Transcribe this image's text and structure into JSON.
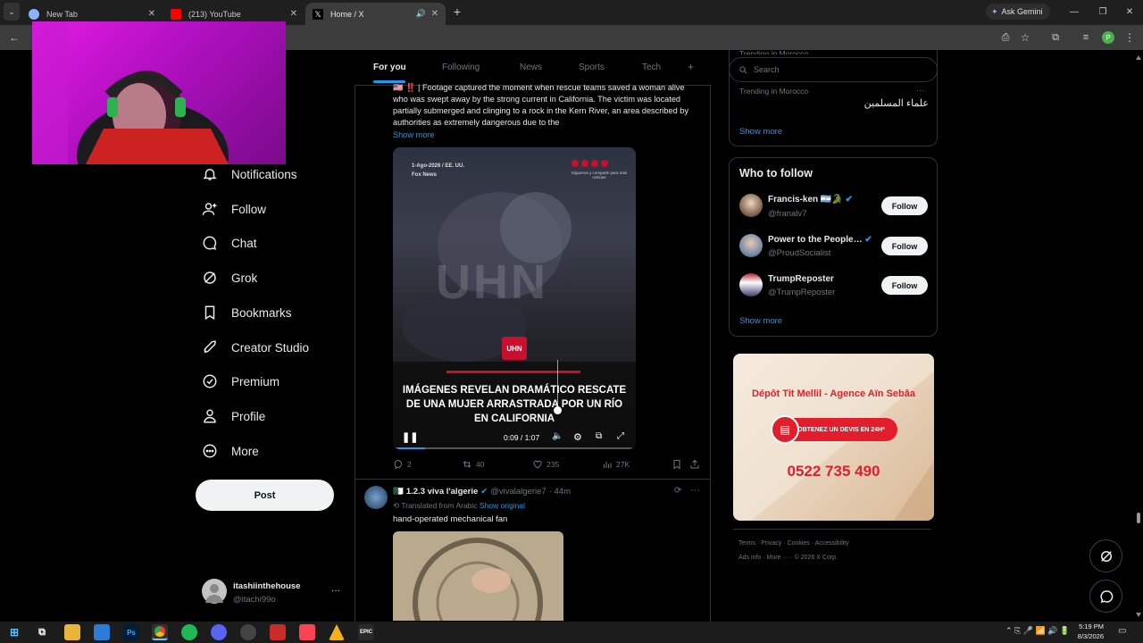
{
  "browser": {
    "tabs": [
      {
        "title": "New Tab"
      },
      {
        "title": "(213) YouTube"
      },
      {
        "title": "Home / X"
      }
    ],
    "ask_gemini": "Ask Gemini",
    "new_tab_symbol": "+"
  },
  "nav": {
    "items": [
      {
        "label": "Notifications",
        "icon": "bell-icon"
      },
      {
        "label": "Follow",
        "icon": "person-plus-icon"
      },
      {
        "label": "Chat",
        "icon": "chat-bubble-icon"
      },
      {
        "label": "Grok",
        "icon": "grok-icon"
      },
      {
        "label": "Bookmarks",
        "icon": "bookmark-icon"
      },
      {
        "label": "Creator Studio",
        "icon": "rocket-icon"
      },
      {
        "label": "Premium",
        "icon": "verified-badge-icon"
      },
      {
        "label": "Profile",
        "icon": "person-icon"
      },
      {
        "label": "More",
        "icon": "more-circle-icon"
      }
    ],
    "post_label": "Post",
    "account": {
      "name": "itashiinthehouse",
      "handle": "@itachi99o",
      "more": "···"
    }
  },
  "feed": {
    "tabs": [
      "For you",
      "Following",
      "News",
      "Sports",
      "Tech"
    ],
    "add_tab": "+",
    "tweet1": {
      "flags": "🇺🇸 ‼️",
      "text": "| Footage captured the moment when rescue teams saved a woman alive who was swept away by the strong current in California. The victim was located partially submerged and clinging to a rock in the Kern River, an area described by authorities as extremely dangerous due to the",
      "show_more": "Show more",
      "video": {
        "date_line": "1-Ago-2026 / EE. UU.",
        "source": "Fox News",
        "social_caption": "Síguenos y comparte para más noticias",
        "watermark": "UHN",
        "logo": "UHN",
        "caption": "IMÁGENES REVELAN DRAMÁTICO RESCATE DE UNA MUJER ARRASTRADA POR UN RÍO EN CALIFORNIA",
        "time": "0:09 / 1:07",
        "progress": 0.134
      },
      "stats": {
        "replies": "2",
        "reposts": "40",
        "likes": "235",
        "views": "27K"
      }
    },
    "tweet2": {
      "name": "1.2.3 viva l'algerie",
      "handle": "@vivalalgerie7",
      "time": "· 44m",
      "translated": "Translated from Arabic",
      "show_original": "Show original",
      "text": "hand-operated mechanical fan",
      "more": "···"
    }
  },
  "right": {
    "search_placeholder": "Search",
    "trend_cut": "Trending in Morocco",
    "trend_label": "Trending in Morocco",
    "trend_title": "علماء المسلمين",
    "trend_more": "···",
    "show_more": "Show more",
    "wtf_title": "Who to follow",
    "wtf": [
      {
        "name": "Francis-ken 🇦🇷🐊",
        "handle": "@franalv7",
        "button": "Follow"
      },
      {
        "name": "Power to the People…",
        "handle": "@ProudSocialist",
        "button": "Follow"
      },
      {
        "name": "TrumpReposter",
        "handle": "@TrumpReposter",
        "button": "Follow"
      }
    ],
    "wtf_more": "Show more",
    "ad": {
      "title": "Dépôt Tit Mellil - Agence Aïn Sebâa",
      "cta": "OBTENEZ UN DEVIS EN 24H*",
      "phone": "0522 735 490"
    },
    "footer": {
      "links": [
        "Terms",
        "Privacy",
        "Cookies",
        "Accessibility",
        "Ads info",
        "More ···"
      ],
      "copyright": "© 2026 X Corp."
    }
  },
  "taskbar": {
    "time": "5:19 PM",
    "date": "8/3/2026",
    "apps": [
      "Ps",
      "Chrome",
      "Spotify",
      "Discord",
      "Git",
      "Roblox",
      "Valorant",
      "Wiz",
      "Epic"
    ]
  },
  "colors": {
    "accent": "#1d9bf0",
    "bg": "#000000",
    "text": "#e7e9ea",
    "muted": "#71767b"
  }
}
